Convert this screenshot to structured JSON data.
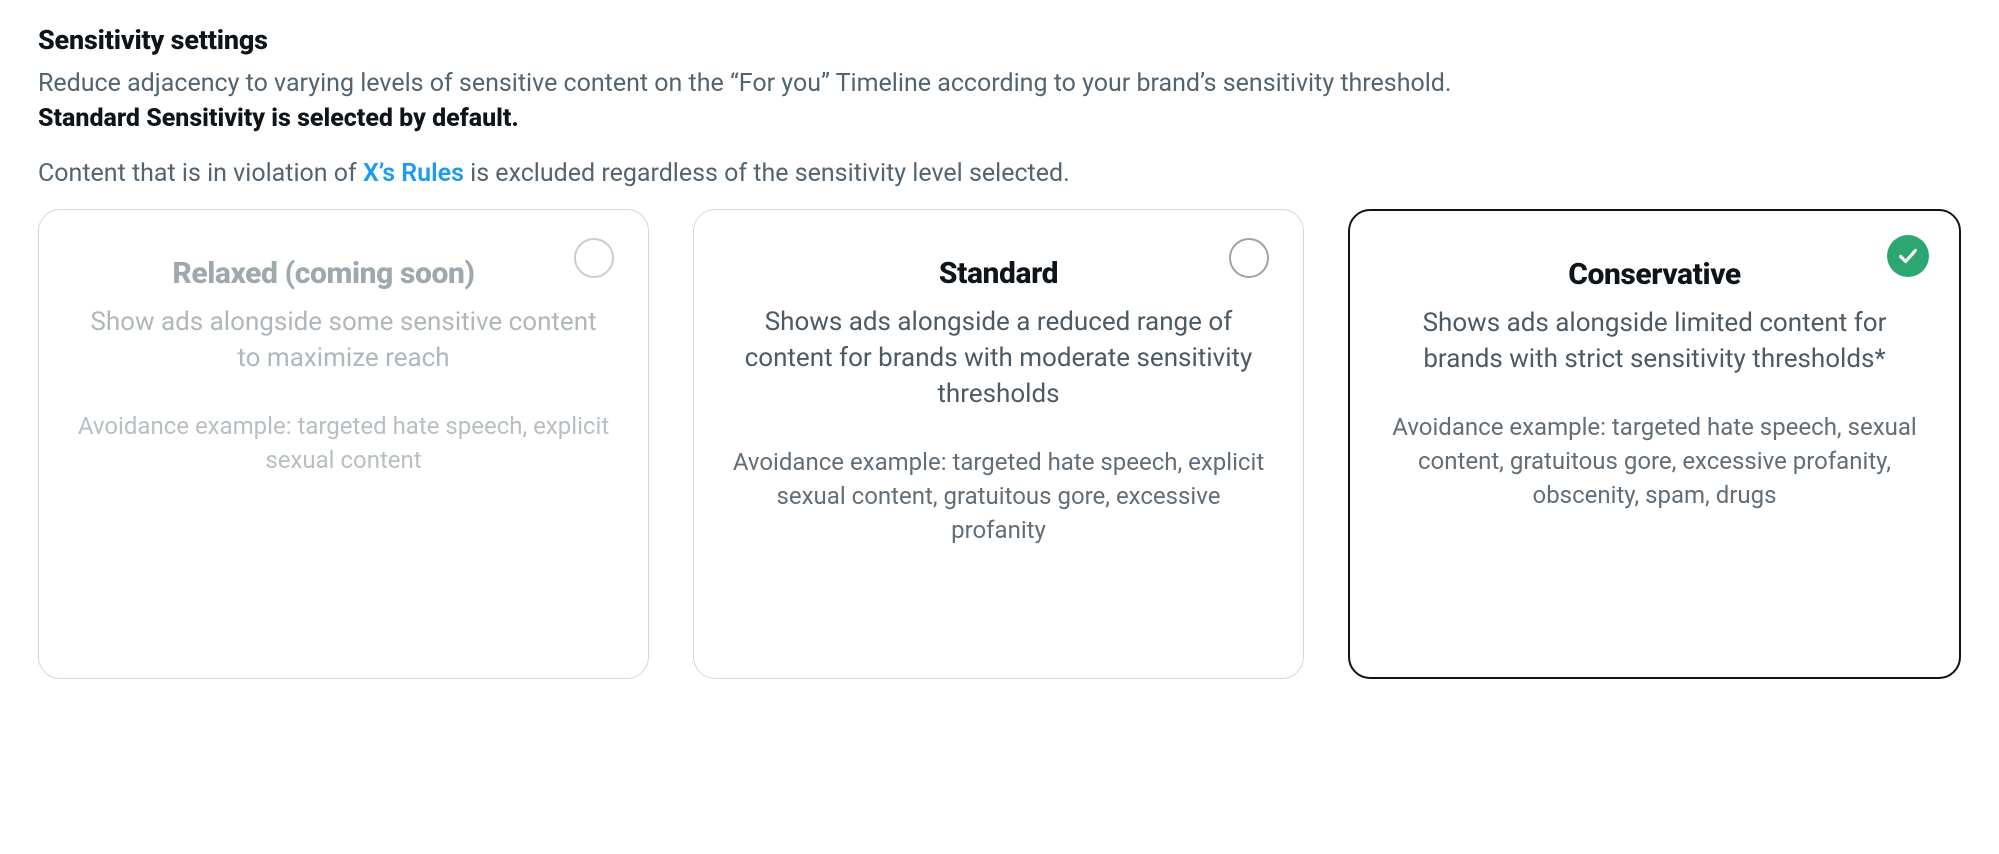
{
  "header": {
    "title": "Sensitivity settings",
    "intro_text": "Reduce adjacency to varying levels of sensitive content on the “For you” Timeline according to your brand’s sensitivity threshold.",
    "intro_bold": "Standard Sensitivity is selected by default.",
    "rules_prefix": "Content that is in violation of ",
    "rules_link_text": "X’s Rules",
    "rules_suffix": " is excluded regardless of the sensitivity level selected."
  },
  "options": {
    "relaxed": {
      "id": "relaxed",
      "title": "Relaxed (coming soon)",
      "body": "Show ads alongside some sensitive content to maximize reach",
      "example": "Avoidance example: targeted hate speech, explicit sexual content",
      "disabled": true,
      "selected": false
    },
    "standard": {
      "id": "standard",
      "title": "Standard",
      "body": "Shows ads alongside a reduced range of content for brands with moderate sensitivity thresholds",
      "example": "Avoidance example: targeted hate speech, explicit sexual content, gratuitous gore, excessive profanity",
      "disabled": false,
      "selected": false
    },
    "conservative": {
      "id": "conservative",
      "title": "Conservative",
      "body": "Shows ads alongside limited content for brands with strict sensitivity thresholds*",
      "example": "Avoidance example: targeted hate speech, sexual content, gratuitous gore, excessive profanity, obscenity, spam, drugs",
      "disabled": false,
      "selected": true
    }
  }
}
